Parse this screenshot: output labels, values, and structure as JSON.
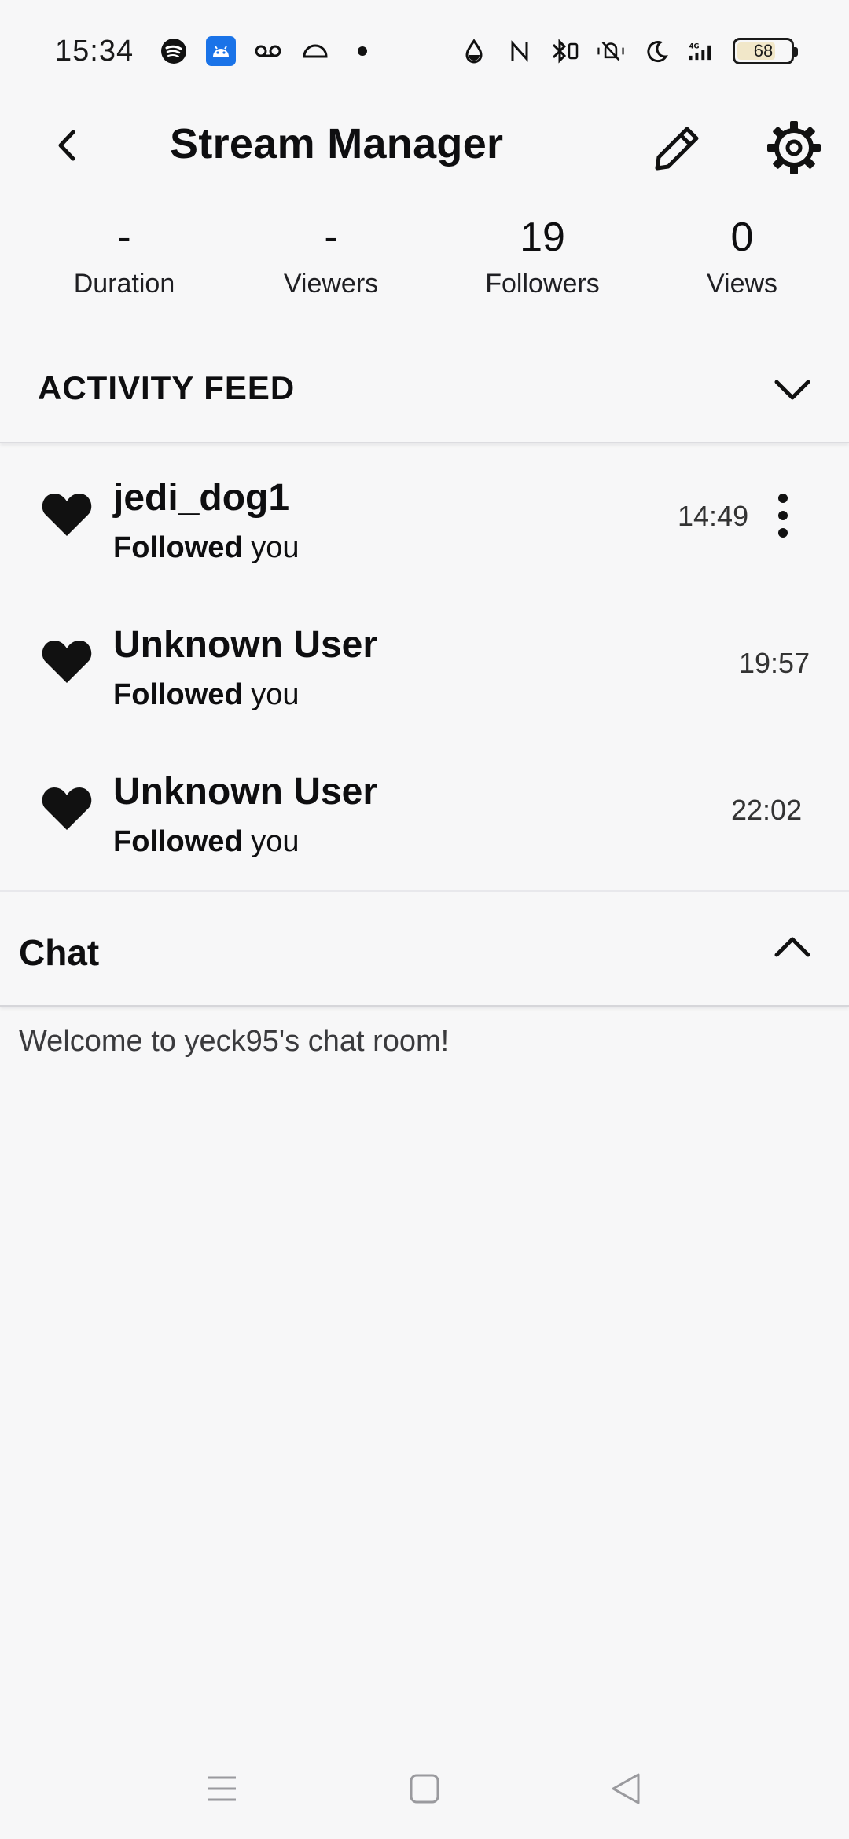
{
  "status_bar": {
    "time": "15:34",
    "left_icons": [
      "spotify-icon",
      "android-app-icon",
      "voicemail-icon",
      "dome-icon",
      "dot-icon"
    ],
    "right_icons": [
      "drop-icon",
      "nfc-icon",
      "bluetooth-icon",
      "mute-icon",
      "moon-icon",
      "signal-4g-icon"
    ],
    "battery_level": "68"
  },
  "header": {
    "title": "Stream Manager",
    "icons": [
      "back-icon",
      "pencil-icon",
      "gear-icon"
    ]
  },
  "stats": [
    {
      "value": "-",
      "label": "Duration"
    },
    {
      "value": "-",
      "label": "Viewers"
    },
    {
      "value": "19",
      "label": "Followers"
    },
    {
      "value": "0",
      "label": "Views"
    }
  ],
  "activity_feed": {
    "title": "ACTIVITY FEED",
    "items": [
      {
        "user": "jedi_dog1",
        "action_bold": "Followed",
        "action_rest": " you",
        "time": "14:49",
        "has_menu": true
      },
      {
        "user": "Unknown User",
        "action_bold": "Followed",
        "action_rest": " you",
        "time": "19:57",
        "has_menu": false
      },
      {
        "user": "Unknown User",
        "action_bold": "Followed",
        "action_rest": " you",
        "time": "22:02",
        "has_menu": false
      }
    ]
  },
  "chat": {
    "title": "Chat",
    "welcome": "Welcome to yeck95's chat room!"
  },
  "colors": {
    "background": "#f7f7f8",
    "text": "#0e0e10",
    "android_icon_bg": "#1a73e8"
  }
}
